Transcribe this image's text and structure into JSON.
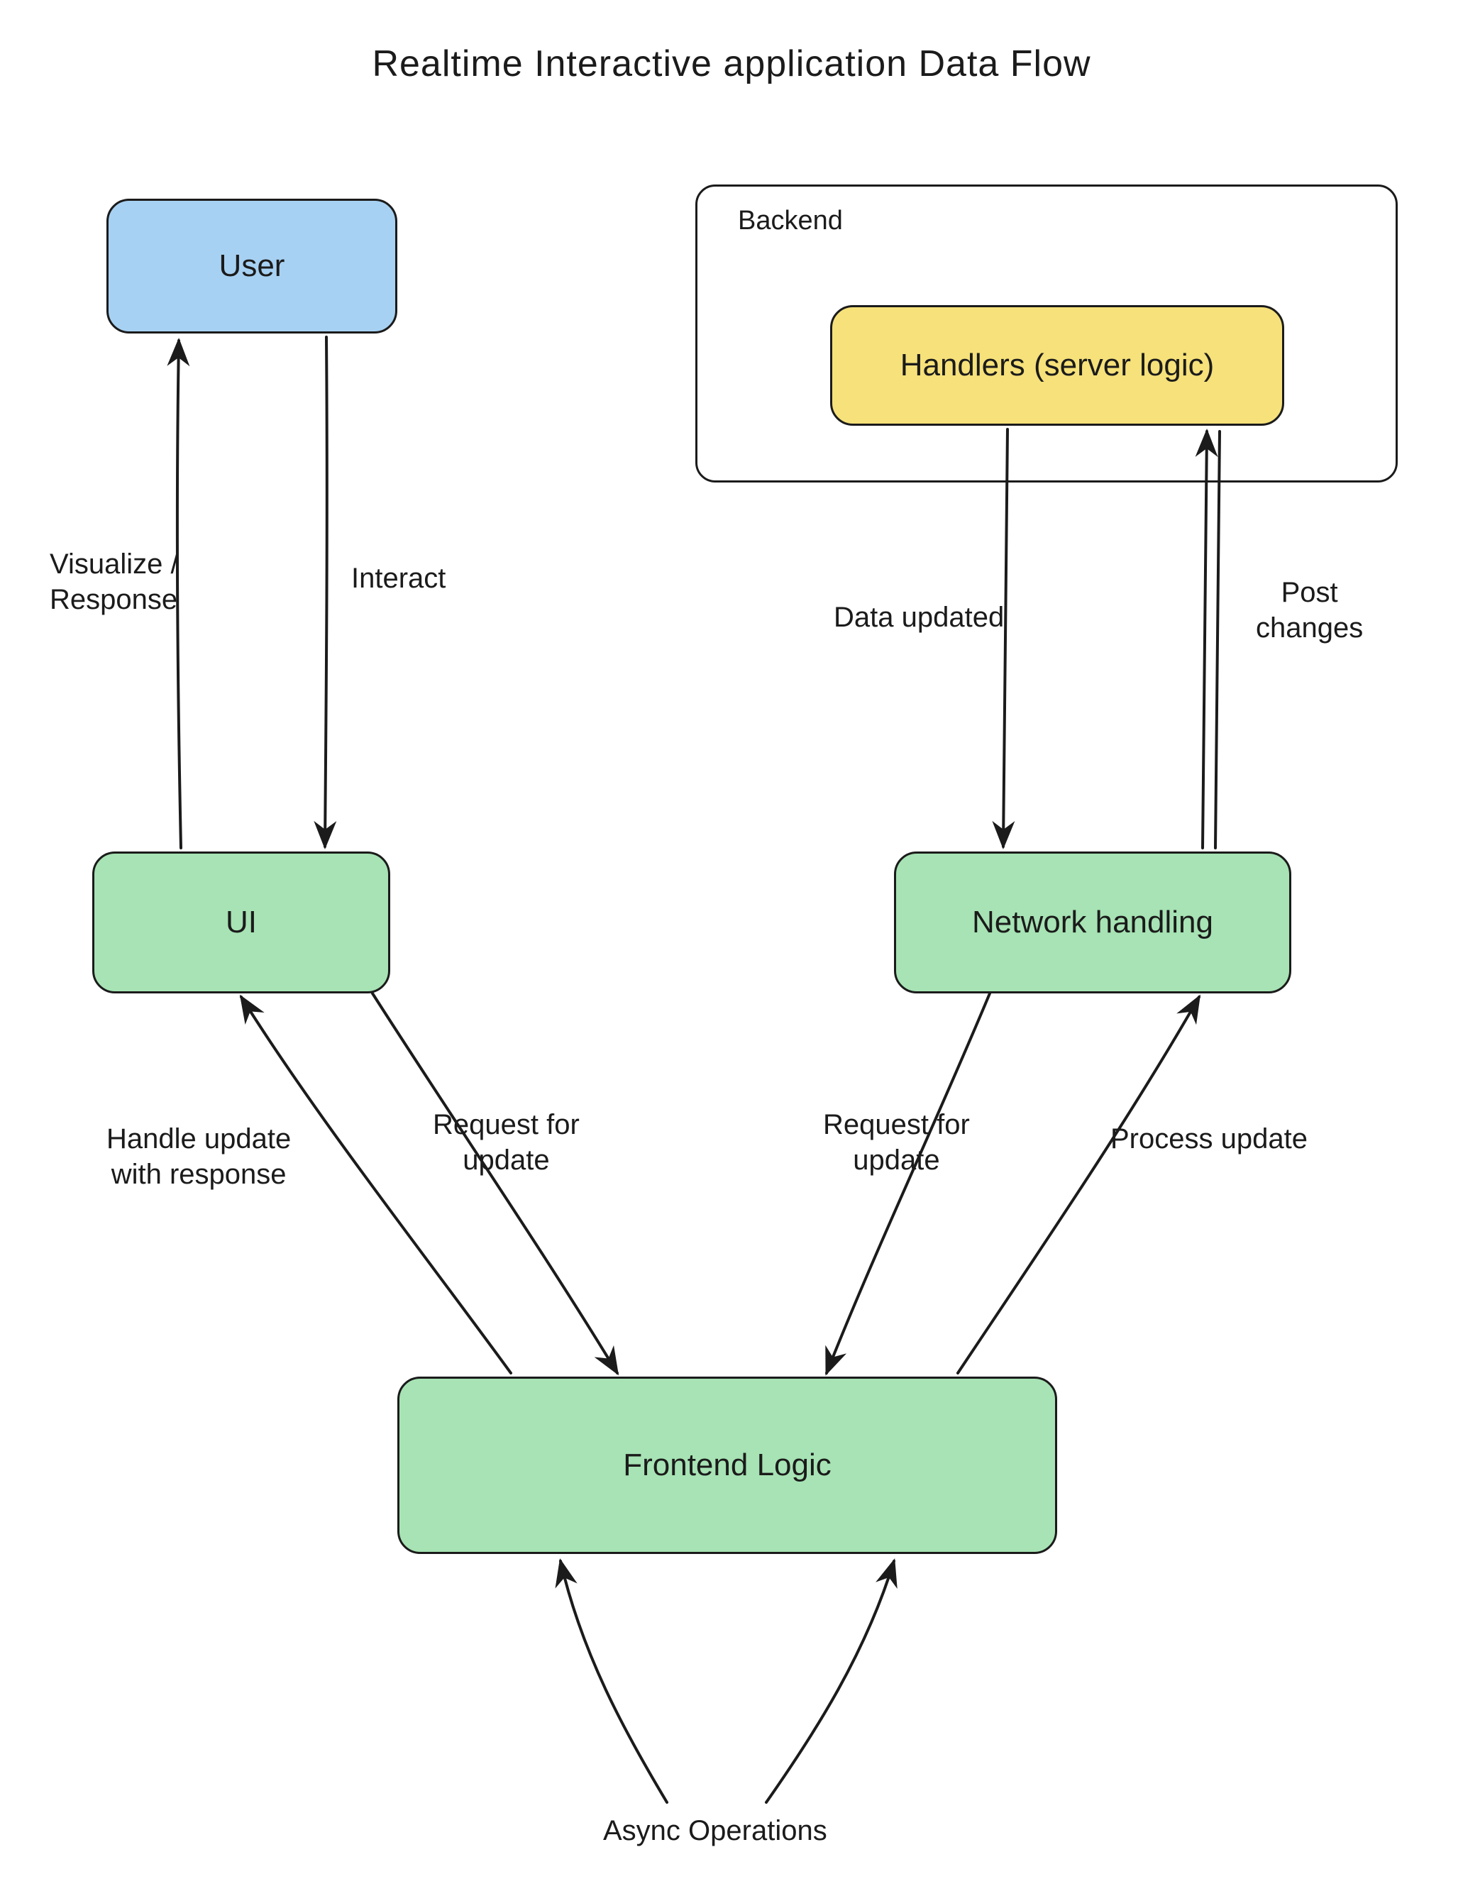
{
  "title": "Realtime Interactive application Data Flow",
  "nodes": {
    "user": {
      "label": "User"
    },
    "ui": {
      "label": "UI"
    },
    "network": {
      "label": "Network handling"
    },
    "frontend": {
      "label": "Frontend Logic"
    },
    "handlers": {
      "label": "Handlers (server logic)"
    }
  },
  "groups": {
    "backend": {
      "label": "Backend"
    }
  },
  "edges": {
    "visualize": {
      "label": "Visualize /\nResponse"
    },
    "interact": {
      "label": "Interact"
    },
    "handleUpdate": {
      "label": "Handle update\nwith response"
    },
    "reqUpdateLeft": {
      "label": "Request for\nupdate"
    },
    "reqUpdateRight": {
      "label": "Request for\nupdate"
    },
    "processUpdate": {
      "label": "Process update"
    },
    "dataUpdated": {
      "label": "Data updated"
    },
    "postChanges": {
      "label": "Post\nchanges"
    },
    "asyncOps": {
      "label": "Async Operations"
    }
  },
  "colors": {
    "blue": "#a7d1f2",
    "green": "#a7e3b4",
    "yellow": "#f6e17a",
    "stroke": "#1b1b1b"
  }
}
